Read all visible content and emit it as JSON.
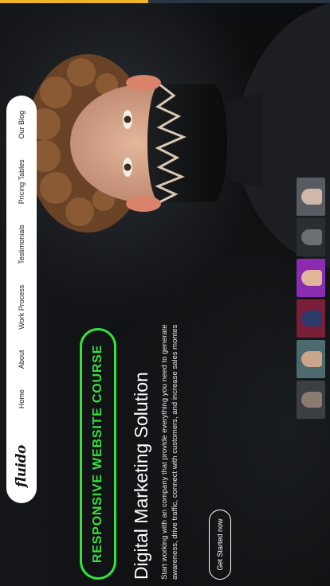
{
  "brand": {
    "logo_text": "fluido"
  },
  "nav": {
    "items": [
      "Home",
      "About",
      "Work Process",
      "Testimonials",
      "Pricing Tables",
      "Our Blog"
    ]
  },
  "hero": {
    "badge": "RESPONSIVE WEBSITE COURSE",
    "title": "Digital Marketing Solution",
    "description": "Start working with an company that provide everything you need to generate awareness, drive traffic, connect with customers, and increase sales montes",
    "cta_label": "Get Started now"
  },
  "top_progress": {
    "fraction": 0.45
  },
  "colors": {
    "accent_green": "#35e23b",
    "progress_yellow": "#f0b429",
    "background": "#0d0f11"
  },
  "thumbnails": [
    {
      "name": "thumb-1",
      "bg": "#3a3f44",
      "fig": "#8a7a70"
    },
    {
      "name": "thumb-2",
      "bg": "#4d6b6e",
      "fig": "#c9a58c"
    },
    {
      "name": "thumb-3",
      "bg": "#7a1f3a",
      "fig": "#2b3a6a"
    },
    {
      "name": "thumb-4",
      "bg": "#8a2bb0",
      "fig": "#e0b59a"
    },
    {
      "name": "thumb-5",
      "bg": "#2a2d31",
      "fig": "#6b6f74"
    },
    {
      "name": "thumb-6",
      "bg": "#565c62",
      "fig": "#d0b8a8"
    }
  ]
}
